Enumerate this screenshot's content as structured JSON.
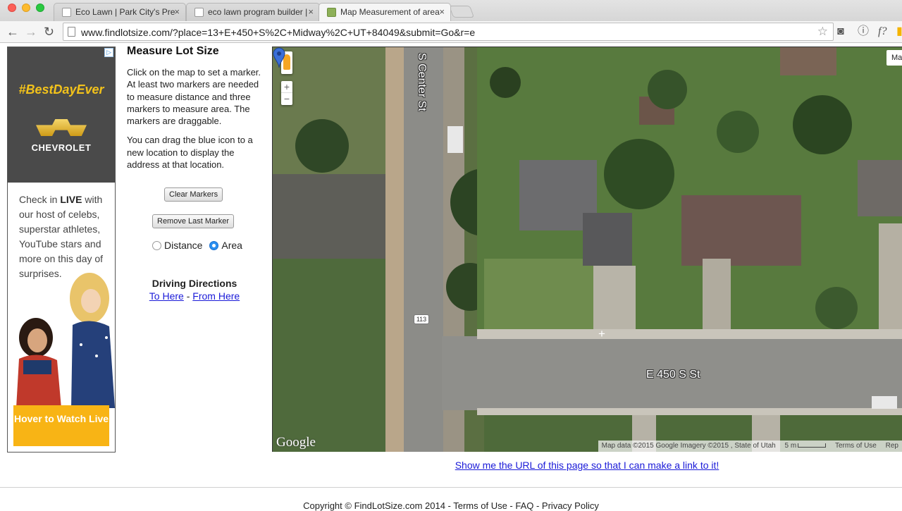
{
  "browser": {
    "tabs": [
      {
        "title": "Eco Lawn | Park City's Pre"
      },
      {
        "title": "eco lawn program builder |"
      },
      {
        "title": "Map Measurement of area"
      }
    ],
    "tab_close": "×",
    "url": "www.findlotsize.com/?place=13+E+450+S%2C+Midway%2C+UT+84049&submit=Go&r=e",
    "nav": {
      "back": "←",
      "forward": "→",
      "reload": "↻",
      "star": "☆"
    },
    "extensions": {
      "pocket": "◙",
      "info": "ⓘ",
      "formula": "f?",
      "more": "▮"
    }
  },
  "ad": {
    "adchoices": "▷",
    "hashtag": "#BestDayEver",
    "brand": "CHEVROLET",
    "promo_prefix": "Check in ",
    "promo_bold": "LIVE",
    "promo_rest": " with our host of celebs, superstar athletes, YouTube stars and more on this day of surprises.",
    "cta": "Hover to Watch Live",
    "colors": {
      "hashtag": "#f2c21b",
      "cta": "#f8b415"
    }
  },
  "panel": {
    "title": "Measure Lot Size",
    "intro": "Click on the map to set a marker. At least two markers are needed to measure distance and three markers to measure area. The markers are draggable.",
    "drag_note": "You can drag the blue icon to a new location to display the address at that location.",
    "clear_button": "Clear Markers",
    "remove_button": "Remove Last Marker",
    "mode_distance": "Distance",
    "mode_area": "Area",
    "selected_mode": "Area",
    "directions_title": "Driving Directions",
    "to_here": "To Here",
    "separator": "-",
    "from_here": "From Here"
  },
  "map": {
    "street_vertical": "S Center St",
    "street_horizontal": "E 450 S St",
    "route_shield": "113",
    "zoom_in": "+",
    "zoom_out": "−",
    "map_type": "Ma",
    "logo": "Google",
    "attribution": "Map data ©2015 Google Imagery ©2015 , State of Utah",
    "scale": "5 m",
    "terms": "Terms of Use",
    "report": "Rep",
    "crosshair": "+",
    "marker_color": "#3b6fd8"
  },
  "share_link": "Show me the URL of this page so that I can make a link to it!",
  "footer": "Copyright © FindLotSize.com 2014 - Terms of Use - FAQ - Privacy Policy"
}
